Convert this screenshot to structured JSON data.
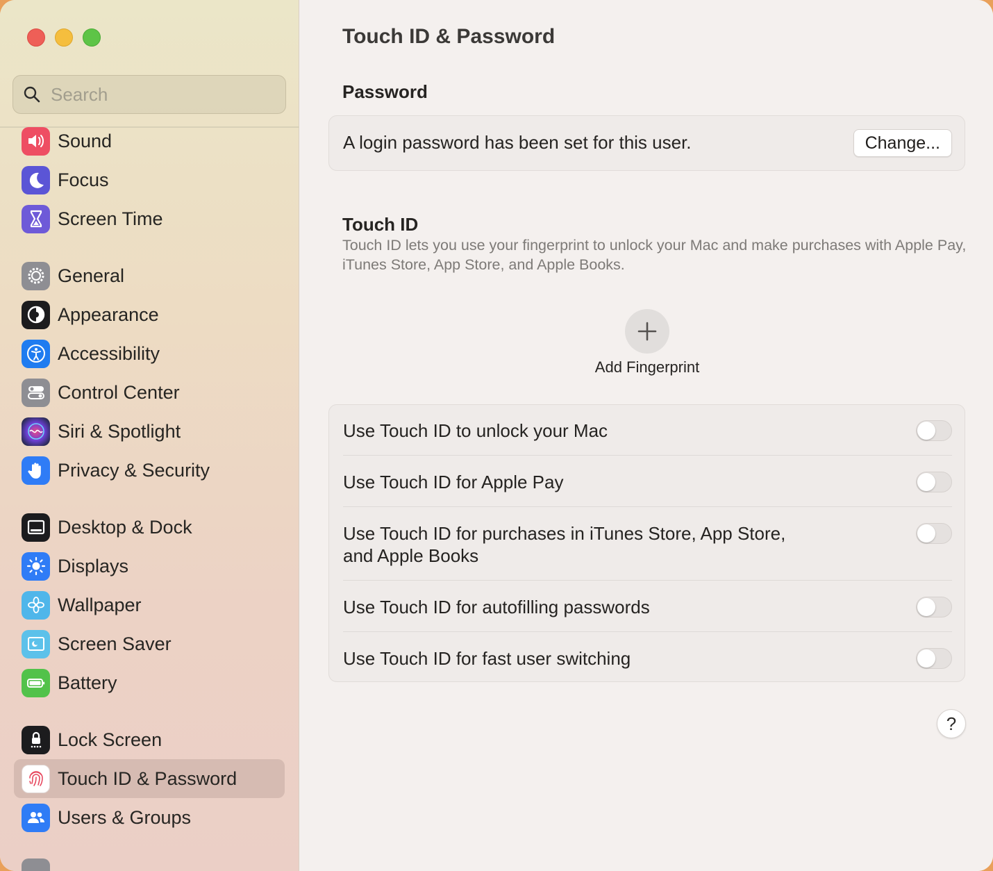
{
  "window": {
    "title": "Touch ID & Password"
  },
  "search": {
    "placeholder": "Search",
    "value": ""
  },
  "sidebar": {
    "items": [
      {
        "label": "Sound",
        "icon": "speaker-icon",
        "color": "#ee4e63"
      },
      {
        "label": "Focus",
        "icon": "moon-icon",
        "color": "#5b55d6"
      },
      {
        "label": "Screen Time",
        "icon": "hourglass-icon",
        "color": "#6e5ad8"
      },
      {
        "label": "General",
        "icon": "gear-icon",
        "color": "#8e8e93"
      },
      {
        "label": "Appearance",
        "icon": "appearance-icon",
        "color": "#1c1c1e"
      },
      {
        "label": "Accessibility",
        "icon": "accessibility-icon",
        "color": "#1f7cf0"
      },
      {
        "label": "Control Center",
        "icon": "toggles-icon",
        "color": "#8e8e93"
      },
      {
        "label": "Siri & Spotlight",
        "icon": "siri-icon",
        "color": "#2d2d5a"
      },
      {
        "label": "Privacy & Security",
        "icon": "hand-icon",
        "color": "#2f7cf6"
      },
      {
        "label": "Desktop & Dock",
        "icon": "dock-icon",
        "color": "#1c1c1e"
      },
      {
        "label": "Displays",
        "icon": "sun-icon",
        "color": "#2f7cf6"
      },
      {
        "label": "Wallpaper",
        "icon": "flower-icon",
        "color": "#4fb6ea"
      },
      {
        "label": "Screen Saver",
        "icon": "screensaver-icon",
        "color": "#5cc1ea"
      },
      {
        "label": "Battery",
        "icon": "battery-icon",
        "color": "#52c24a"
      },
      {
        "label": "Lock Screen",
        "icon": "lock-icon",
        "color": "#1c1c1e"
      },
      {
        "label": "Touch ID & Password",
        "icon": "fingerprint-icon",
        "color": "#ffffff",
        "selected": true
      },
      {
        "label": "Users & Groups",
        "icon": "users-icon",
        "color": "#2f7cf6"
      }
    ]
  },
  "main": {
    "title": "Touch ID & Password",
    "password": {
      "section_title": "Password",
      "status_text": "A login password has been set for this user.",
      "change_label": "Change..."
    },
    "touch_id": {
      "section_title": "Touch ID",
      "description": "Touch ID lets you use your fingerprint to unlock your Mac and make purchases with Apple Pay, iTunes Store, App Store, and Apple Books.",
      "add_fingerprint_label": "Add Fingerprint",
      "options": [
        {
          "label": "Use Touch ID to unlock your Mac",
          "enabled": false
        },
        {
          "label": "Use Touch ID for Apple Pay",
          "enabled": false
        },
        {
          "label": "Use Touch ID for purchases in iTunes Store, App Store, and Apple Books",
          "enabled": false
        },
        {
          "label": "Use Touch ID for autofilling passwords",
          "enabled": false
        },
        {
          "label": "Use Touch ID for fast user switching",
          "enabled": false
        }
      ]
    },
    "help_label": "?"
  }
}
